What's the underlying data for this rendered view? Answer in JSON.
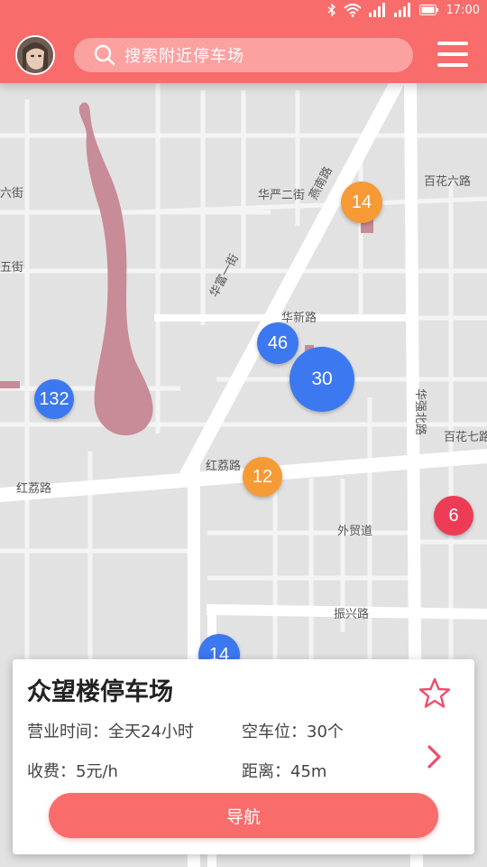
{
  "status_bar": {
    "time": "17:00"
  },
  "header": {
    "search_placeholder": "搜索附近停车场"
  },
  "map": {
    "road_labels": [
      {
        "text": "华严二街"
      },
      {
        "text": "华新路"
      },
      {
        "text": "红荔路"
      },
      {
        "text": "红荔路"
      },
      {
        "text": "百花六路"
      },
      {
        "text": "百花七路"
      },
      {
        "text": "振兴路"
      },
      {
        "text": "燕南路"
      },
      {
        "text": "华强北路"
      },
      {
        "text": "外贸道"
      },
      {
        "text": "六街"
      },
      {
        "text": "五街"
      },
      {
        "text": "华富一街"
      }
    ],
    "markers": [
      {
        "count": "14",
        "color": "orange"
      },
      {
        "count": "46",
        "color": "blue"
      },
      {
        "count": "30",
        "color": "blue"
      },
      {
        "count": "132",
        "color": "blue"
      },
      {
        "count": "12",
        "color": "orange"
      },
      {
        "count": "6",
        "color": "red"
      },
      {
        "count": "14",
        "color": "blue"
      }
    ]
  },
  "card": {
    "name": "众望楼停车场",
    "hours_label": "营业时间：全天24小时",
    "spaces_label": "空车位：30个",
    "fee_label": "收费：5元/h",
    "distance_label": "距离：45m",
    "nav_label": "导航"
  },
  "colors": {
    "accent": "#f86c6b",
    "marker_blue": "#3c78f0",
    "marker_orange": "#f59a35",
    "marker_red": "#ec3c55"
  }
}
